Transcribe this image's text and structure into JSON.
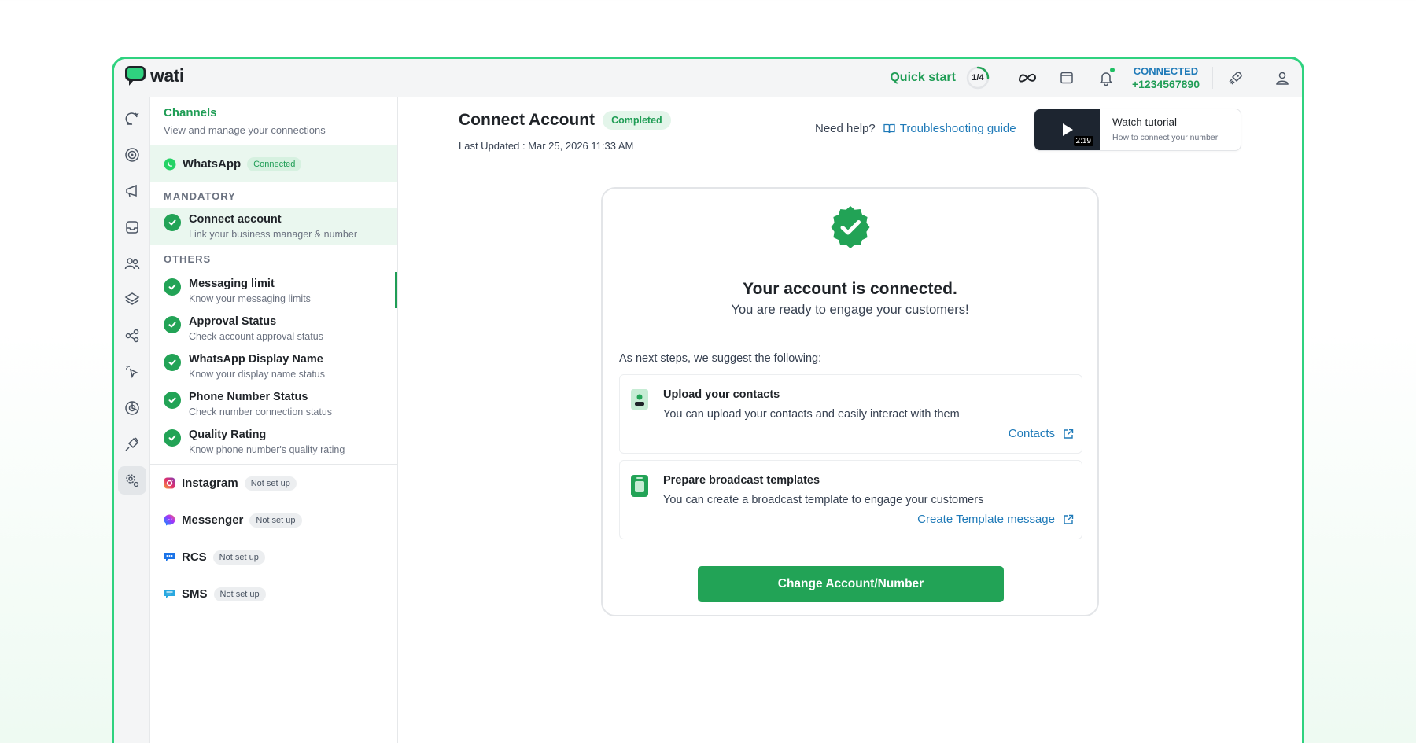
{
  "app": {
    "logo_text": "wati"
  },
  "topbar": {
    "quick_start_label": "Quick start",
    "quick_start_progress": "1/4",
    "quick_start_fraction": 0.25,
    "connection_status": "CONNECTED",
    "phone_number": "+1234567890"
  },
  "channels": {
    "title": "Channels",
    "subtitle": "View and manage your connections",
    "whatsapp": {
      "name": "WhatsApp",
      "badge": "Connected"
    },
    "mandatory_label": "MANDATORY",
    "mandatory_steps": [
      {
        "title": "Connect account",
        "subtitle": "Link your business manager & number"
      }
    ],
    "others_label": "OTHERS",
    "other_steps": [
      {
        "title": "Messaging limit",
        "subtitle": "Know your messaging limits"
      },
      {
        "title": "Approval Status",
        "subtitle": "Check account approval status"
      },
      {
        "title": "WhatsApp Display Name",
        "subtitle": "Know your display name status"
      },
      {
        "title": "Phone Number Status",
        "subtitle": "Check number connection status"
      },
      {
        "title": "Quality Rating",
        "subtitle": "Know phone number's quality rating"
      }
    ],
    "other_channels": [
      {
        "name": "Instagram",
        "badge": "Not set up"
      },
      {
        "name": "Messenger",
        "badge": "Not set up"
      },
      {
        "name": "RCS",
        "badge": "Not set up"
      },
      {
        "name": "SMS",
        "badge": "Not set up"
      }
    ]
  },
  "main": {
    "title": "Connect Account",
    "status_badge": "Completed",
    "last_updated": "Last Updated : Mar 25, 2026 11:33 AM",
    "help_label": "Need help?",
    "help_link": "Troubleshooting guide",
    "tutorial": {
      "title": "Watch tutorial",
      "subtitle": "How to connect your number",
      "duration": "2:19"
    },
    "connected_title": "Your account is connected.",
    "connected_subtitle": "You are ready to engage your customers!",
    "next_steps_label": "As next steps, we suggest the following:",
    "suggestions": [
      {
        "title": "Upload your contacts",
        "description": "You can upload your contacts and easily interact with them",
        "link": "Contacts"
      },
      {
        "title": "Prepare broadcast templates",
        "description": "You can create a broadcast template to engage your customers",
        "link": "Create Template message"
      }
    ],
    "primary_button": "Change Account/Number"
  },
  "icons": {
    "rail": [
      "chat-refresh-icon",
      "target-icon",
      "megaphone-icon",
      "inbox-icon",
      "users-icon",
      "layers-icon",
      "share-nodes-icon",
      "cursor-click-icon",
      "pie-chart-icon",
      "plug-icon",
      "settings-icon"
    ]
  },
  "colors": {
    "brand_green": "#22a356",
    "accent_green": "#2fd27f",
    "link_blue": "#1f7ab8"
  }
}
